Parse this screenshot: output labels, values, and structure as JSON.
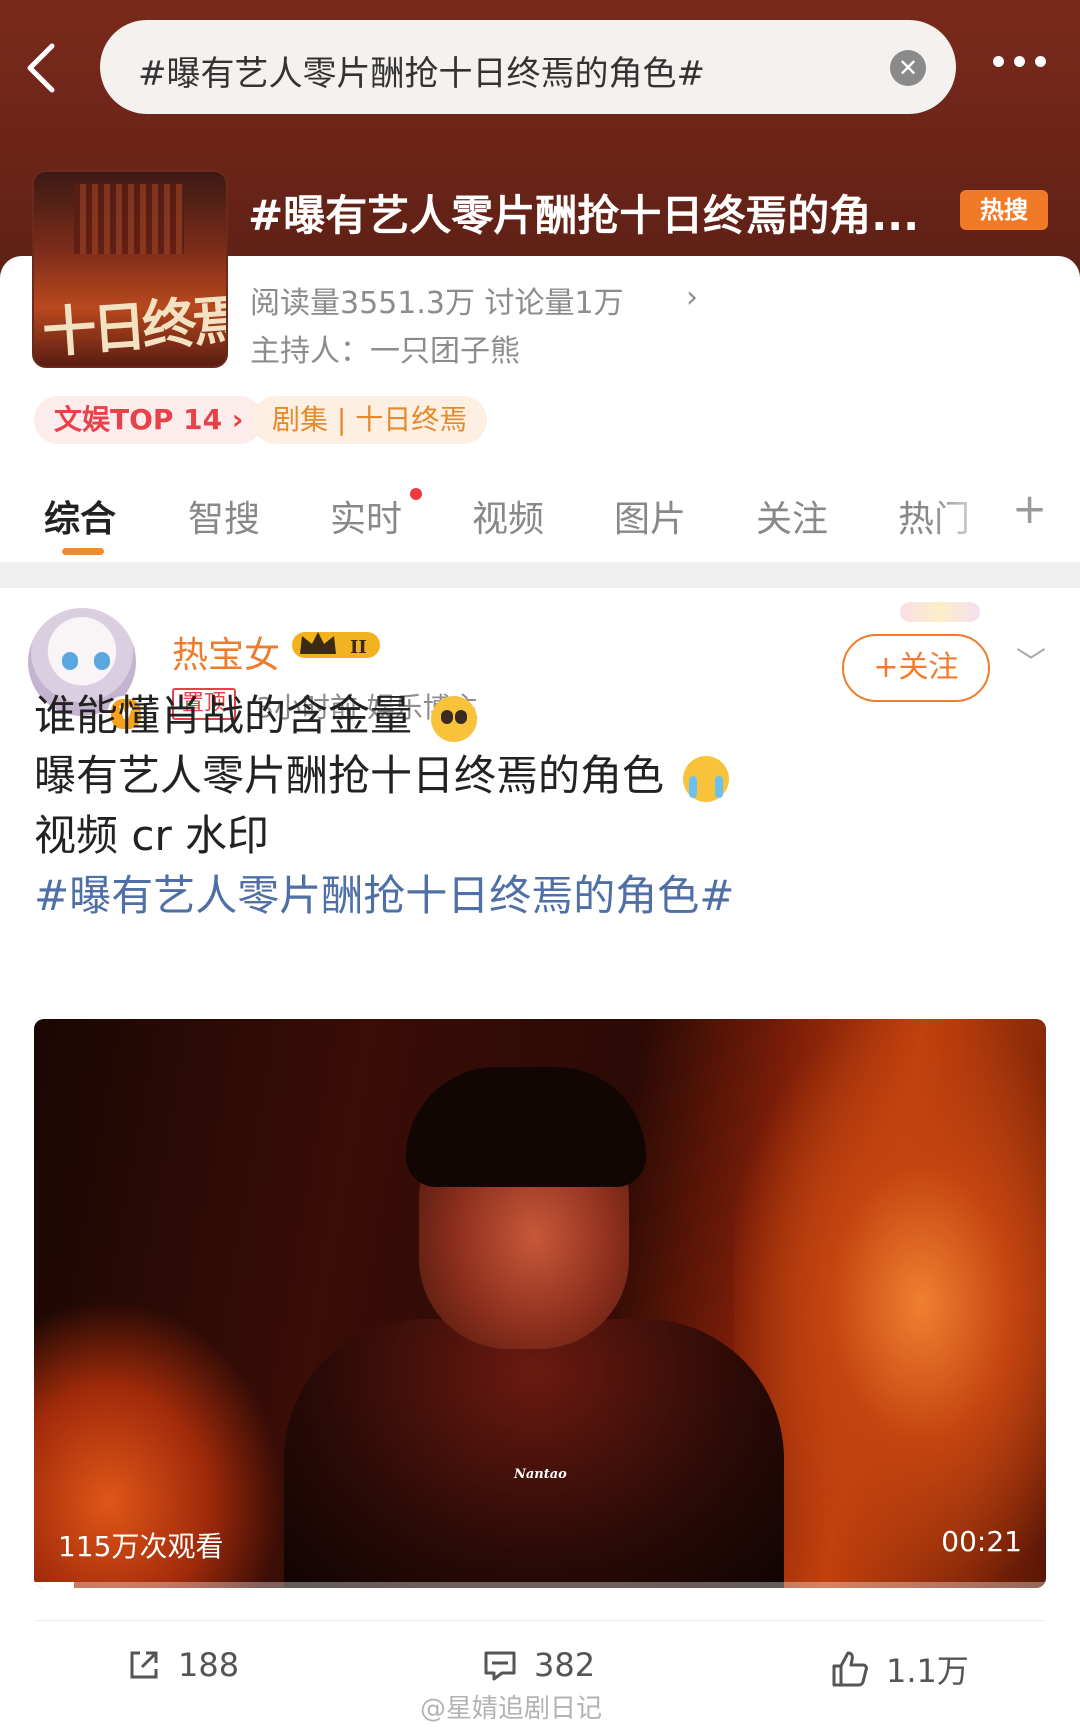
{
  "search": {
    "query": "#曝有艺人零片酬抢十日终焉的角色#"
  },
  "topic": {
    "title": "#曝有艺人零片酬抢十日终焉的角...",
    "hot_badge": "热搜",
    "cover_text": "十日终焉",
    "stats": "阅读量3551.3万  讨论量1万",
    "host": "主持人：一只团子熊",
    "tag_rank": "文娱TOP 14 ›",
    "tag_series": "剧集 | 十日终焉"
  },
  "tabs": [
    "综合",
    "智搜",
    "实时",
    "视频",
    "图片",
    "关注",
    "热门"
  ],
  "post": {
    "username": "热宝女",
    "pinned_label": "置顶",
    "meta": "3小时前  娱乐博主",
    "follow_label": "+关注",
    "lines": [
      "谁能懂肖战的含金量",
      "曝有艺人零片酬抢十日终焉的角色",
      "视频 cr 水印",
      "#曝有艺人零片酬抢十日终焉的角色#"
    ],
    "video": {
      "views": "115万次观看",
      "duration": "00:21",
      "watermark": "Nantao",
      "progress": 0.04
    },
    "actions": {
      "share": "188",
      "comments": "382",
      "likes": "1.1万"
    }
  },
  "footer_watermark": "@星婧追剧日记",
  "colors": {
    "accent": "#f07b2a",
    "topic_link": "#4f6fa7",
    "header": "#6a2418"
  }
}
